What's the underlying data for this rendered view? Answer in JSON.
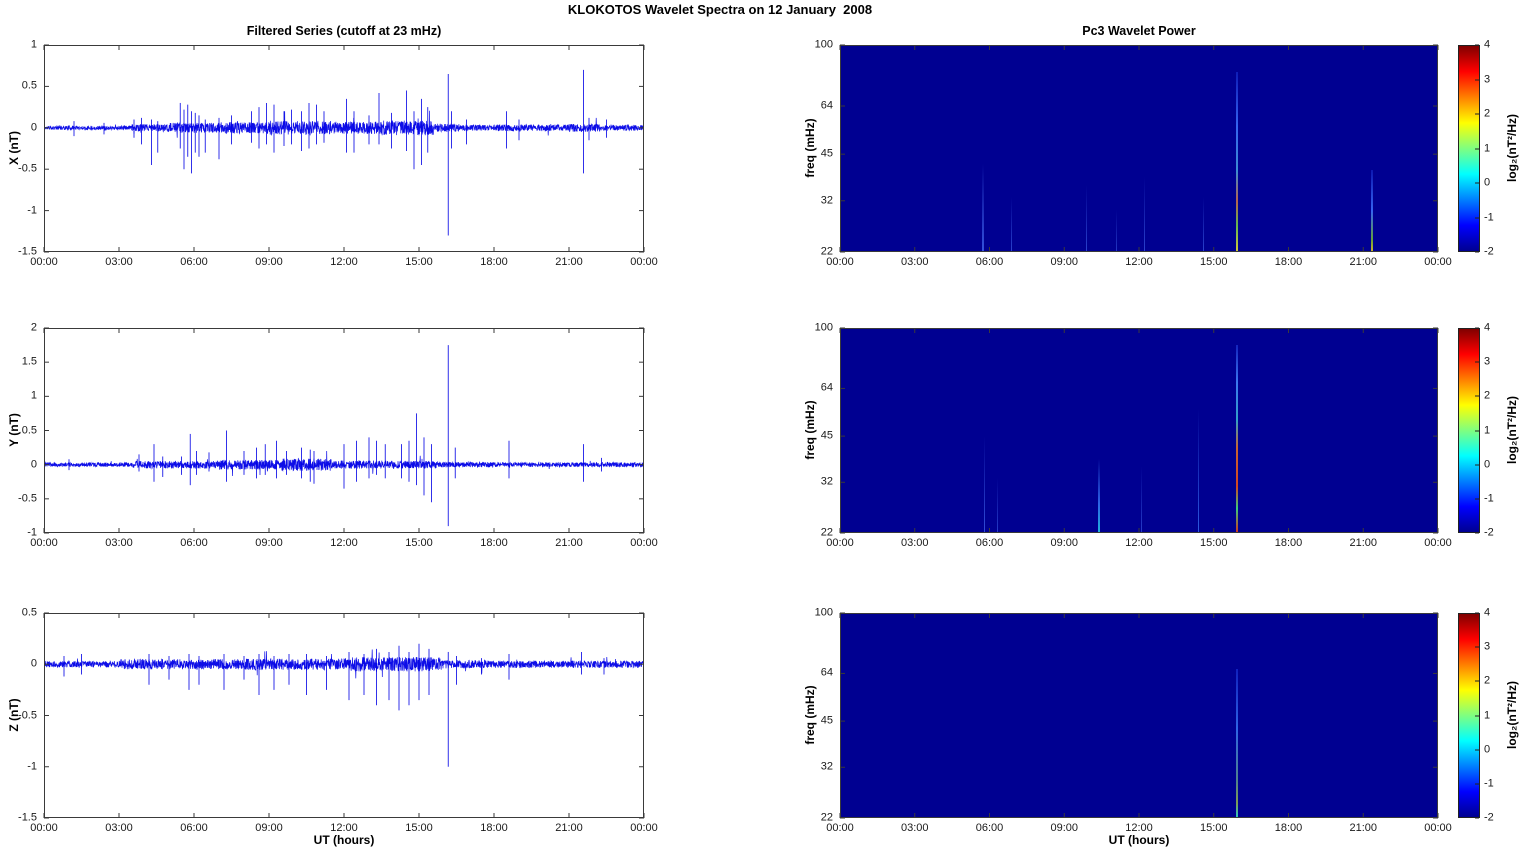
{
  "figure_title": "KLOKOTOS Wavelet Spectra on 12 January  2008",
  "xlabel": "UT (hours)",
  "x_tick_labels": [
    "00:00",
    "03:00",
    "06:00",
    "09:00",
    "12:00",
    "15:00",
    "18:00",
    "21:00",
    "00:00"
  ],
  "colors": {
    "series_line": "#0000E6",
    "spectrogram_background": "#000091",
    "axis": "#3a3a3a",
    "figure_background": "#ffffff"
  },
  "colorbar": {
    "label": "log₂(nT²/Hz)",
    "min": -2,
    "max": 4,
    "ticks": [
      "4",
      "3",
      "2",
      "1",
      "0",
      "-1",
      "-2"
    ],
    "gradient": [
      [
        "#000091",
        0
      ],
      [
        "#0000ff",
        12.5
      ],
      [
        "#00ffff",
        37.5
      ],
      [
        "#ffff00",
        62.5
      ],
      [
        "#ff0000",
        87.5
      ],
      [
        "#800000",
        100
      ]
    ]
  },
  "chart_data": [
    {
      "type": "line",
      "name": "X filtered series",
      "title": "Filtered Series (cutoff at 23 mHz)",
      "ylabel": "X (nT)",
      "ylim": [
        -1.5,
        1
      ],
      "yticks": [
        [
          1,
          "1"
        ],
        [
          0.5,
          "0.5"
        ],
        [
          0,
          "0"
        ],
        [
          -0.5,
          "-0.5"
        ],
        [
          -1,
          "-1"
        ],
        [
          -1.5,
          "-1.5"
        ]
      ],
      "xlim_hours": [
        0,
        24
      ],
      "seed": 11,
      "noise_envelope": [
        [
          0,
          3.5,
          0.025
        ],
        [
          3.5,
          5,
          0.045
        ],
        [
          5,
          7,
          0.06
        ],
        [
          7,
          9,
          0.07
        ],
        [
          9,
          11.5,
          0.085
        ],
        [
          11.5,
          13.5,
          0.075
        ],
        [
          13.5,
          15.6,
          0.09
        ],
        [
          15.6,
          16.6,
          0.05
        ],
        [
          16.6,
          18,
          0.035
        ],
        [
          18,
          21,
          0.04
        ],
        [
          21,
          22.3,
          0.05
        ],
        [
          22.3,
          24,
          0.035
        ]
      ],
      "spikes": [
        [
          1.2,
          0.08,
          -0.1
        ],
        [
          2.4,
          0.06,
          -0.08
        ],
        [
          3.6,
          0.1,
          -0.12
        ],
        [
          3.9,
          0.12,
          -0.2
        ],
        [
          4.3,
          0.1,
          -0.45
        ],
        [
          4.55,
          0.08,
          -0.3
        ],
        [
          5.45,
          0.3,
          -0.25
        ],
        [
          5.6,
          0.22,
          -0.5
        ],
        [
          5.75,
          0.28,
          -0.35
        ],
        [
          5.9,
          0.2,
          -0.55
        ],
        [
          6.05,
          0.18,
          -0.3
        ],
        [
          6.2,
          0.15,
          -0.35
        ],
        [
          6.45,
          0.1,
          -0.3
        ],
        [
          7.0,
          0.12,
          -0.38
        ],
        [
          7.5,
          0.15,
          -0.2
        ],
        [
          8.3,
          0.2,
          -0.18
        ],
        [
          8.6,
          0.25,
          -0.25
        ],
        [
          8.9,
          0.3,
          -0.2
        ],
        [
          9.2,
          0.28,
          -0.3
        ],
        [
          9.6,
          0.2,
          -0.22
        ],
        [
          9.9,
          0.22,
          -0.2
        ],
        [
          10.3,
          0.2,
          -0.28
        ],
        [
          10.6,
          0.3,
          -0.25
        ],
        [
          10.9,
          0.28,
          -0.2
        ],
        [
          11.2,
          0.2,
          -0.18
        ],
        [
          12.1,
          0.35,
          -0.3
        ],
        [
          12.4,
          0.2,
          -0.3
        ],
        [
          13.0,
          0.15,
          -0.2
        ],
        [
          13.4,
          0.42,
          -0.2
        ],
        [
          13.9,
          0.18,
          -0.25
        ],
        [
          14.5,
          0.45,
          -0.28
        ],
        [
          14.8,
          0.2,
          -0.5
        ],
        [
          15.1,
          0.35,
          -0.45
        ],
        [
          15.35,
          0.25,
          -0.3
        ],
        [
          16.17,
          0.65,
          -1.3
        ],
        [
          16.3,
          0.2,
          -0.25
        ],
        [
          16.9,
          0.1,
          -0.2
        ],
        [
          18.5,
          0.2,
          -0.25
        ],
        [
          19.0,
          0.1,
          -0.15
        ],
        [
          21.58,
          0.7,
          -0.55
        ],
        [
          21.8,
          0.12,
          -0.15
        ],
        [
          22.5,
          0.1,
          -0.12
        ]
      ]
    },
    {
      "type": "heatmap",
      "name": "X Pc3 wavelet power",
      "title": "Pc3 Wavelet Power",
      "ylabel": "freq (mHz)",
      "yscale": "log",
      "ylim": [
        22,
        100
      ],
      "yticks": [
        [
          100,
          "100"
        ],
        [
          64,
          "64"
        ],
        [
          45,
          "45"
        ],
        [
          32,
          "32"
        ],
        [
          22,
          "22"
        ]
      ],
      "xlim_hours": [
        0,
        24
      ],
      "background_value": -2,
      "events": [
        {
          "t": 5.75,
          "f_top": 42,
          "w": 2,
          "stops": [
            [
              0,
              "rgba(60,95,235,0)"
            ],
            [
              100,
              "rgba(70,110,245,0.75)"
            ]
          ]
        },
        {
          "t": 6.9,
          "f_top": 33,
          "w": 1,
          "stops": [
            [
              0,
              "rgba(60,95,235,0)"
            ],
            [
              100,
              "rgba(70,110,245,0.6)"
            ]
          ]
        },
        {
          "t": 9.9,
          "f_top": 36,
          "w": 1,
          "stops": [
            [
              0,
              "rgba(60,95,235,0)"
            ],
            [
              100,
              "rgba(70,110,245,0.6)"
            ]
          ]
        },
        {
          "t": 11.1,
          "f_top": 30,
          "w": 1,
          "stops": [
            [
              0,
              "rgba(60,95,235,0)"
            ],
            [
              100,
              "rgba(70,110,245,0.5)"
            ]
          ]
        },
        {
          "t": 12.2,
          "f_top": 38,
          "w": 1,
          "stops": [
            [
              0,
              "rgba(60,95,235,0)"
            ],
            [
              100,
              "rgba(70,110,245,0.6)"
            ]
          ]
        },
        {
          "t": 14.6,
          "f_top": 33,
          "w": 1,
          "stops": [
            [
              0,
              "rgba(60,95,235,0)"
            ],
            [
              100,
              "rgba(70,110,245,0.6)"
            ]
          ]
        },
        {
          "t": 15.93,
          "f_top": 82,
          "w": 2,
          "stops": [
            [
              0,
              "rgba(40,80,255,0.35)"
            ],
            [
              30,
              "#3564f0"
            ],
            [
              55,
              "#3c8cd2"
            ],
            [
              72,
              "#b46450"
            ],
            [
              85,
              "#64b450"
            ],
            [
              100,
              "#d2c83c"
            ]
          ]
        },
        {
          "t": 21.35,
          "f_top": 40,
          "w": 2,
          "stops": [
            [
              0,
              "rgba(40,80,255,0.3)"
            ],
            [
              50,
              "#3564f0"
            ],
            [
              85,
              "#64a03c"
            ],
            [
              100,
              "#d2b42a"
            ]
          ]
        }
      ]
    },
    {
      "type": "line",
      "name": "Y filtered series",
      "title": "",
      "ylabel": "Y (nT)",
      "ylim": [
        -1,
        2
      ],
      "yticks": [
        [
          2,
          "2"
        ],
        [
          1.5,
          "1.5"
        ],
        [
          1,
          "1"
        ],
        [
          0.5,
          "0.5"
        ],
        [
          0,
          "0"
        ],
        [
          -0.5,
          "-0.5"
        ],
        [
          -1,
          "-1"
        ]
      ],
      "xlim_hours": [
        0,
        24
      ],
      "seed": 23,
      "noise_envelope": [
        [
          0,
          3.5,
          0.03
        ],
        [
          3.5,
          7,
          0.055
        ],
        [
          7,
          9.5,
          0.07
        ],
        [
          9.5,
          11.5,
          0.09
        ],
        [
          11.5,
          14,
          0.06
        ],
        [
          14,
          15.8,
          0.055
        ],
        [
          15.8,
          18,
          0.04
        ],
        [
          18,
          24,
          0.035
        ]
      ],
      "spikes": [
        [
          1.0,
          0.08,
          -0.08
        ],
        [
          3.8,
          0.15,
          -0.1
        ],
        [
          4.4,
          0.3,
          -0.25
        ],
        [
          4.75,
          0.12,
          -0.18
        ],
        [
          5.5,
          0.12,
          -0.15
        ],
        [
          5.85,
          0.45,
          -0.3
        ],
        [
          6.1,
          0.2,
          -0.15
        ],
        [
          6.6,
          0.18,
          -0.1
        ],
        [
          7.3,
          0.5,
          -0.25
        ],
        [
          8.0,
          0.2,
          -0.15
        ],
        [
          8.5,
          0.25,
          -0.2
        ],
        [
          8.85,
          0.3,
          -0.15
        ],
        [
          9.3,
          0.35,
          -0.2
        ],
        [
          9.7,
          0.2,
          -0.15
        ],
        [
          10.3,
          0.25,
          -0.2
        ],
        [
          10.65,
          0.22,
          -0.25
        ],
        [
          10.8,
          0.2,
          -0.28
        ],
        [
          12.0,
          0.3,
          -0.35
        ],
        [
          12.5,
          0.35,
          -0.25
        ],
        [
          13.0,
          0.4,
          -0.2
        ],
        [
          13.3,
          0.35,
          -0.15
        ],
        [
          13.65,
          0.3,
          -0.2
        ],
        [
          14.3,
          0.3,
          -0.2
        ],
        [
          14.6,
          0.35,
          -0.25
        ],
        [
          14.9,
          0.75,
          -0.3
        ],
        [
          15.2,
          0.4,
          -0.45
        ],
        [
          15.5,
          0.3,
          -0.55
        ],
        [
          16.17,
          1.75,
          -0.9
        ],
        [
          16.45,
          0.25,
          -0.2
        ],
        [
          18.6,
          0.35,
          -0.2
        ],
        [
          21.58,
          0.3,
          -0.25
        ],
        [
          22.3,
          0.1,
          -0.1
        ]
      ]
    },
    {
      "type": "heatmap",
      "name": "Y Pc3 wavelet power",
      "title": "",
      "ylabel": "freq (mHz)",
      "yscale": "log",
      "ylim": [
        22,
        100
      ],
      "yticks": [
        [
          100,
          "100"
        ],
        [
          64,
          "64"
        ],
        [
          45,
          "45"
        ],
        [
          32,
          "32"
        ],
        [
          22,
          "22"
        ]
      ],
      "xlim_hours": [
        0,
        24
      ],
      "background_value": -2,
      "events": [
        {
          "t": 5.8,
          "f_top": 45,
          "w": 1,
          "stops": [
            [
              0,
              "rgba(60,95,235,0)"
            ],
            [
              100,
              "rgba(70,110,245,0.7)"
            ]
          ]
        },
        {
          "t": 6.3,
          "f_top": 33,
          "w": 1,
          "stops": [
            [
              0,
              "rgba(60,95,235,0)"
            ],
            [
              100,
              "rgba(70,110,245,0.55)"
            ]
          ]
        },
        {
          "t": 10.4,
          "f_top": 38,
          "w": 2,
          "stops": [
            [
              0,
              "rgba(60,95,235,0)"
            ],
            [
              60,
              "#2e64e6"
            ],
            [
              100,
              "#1eb4dc"
            ]
          ]
        },
        {
          "t": 12.1,
          "f_top": 36,
          "w": 1,
          "stops": [
            [
              0,
              "rgba(60,95,235,0)"
            ],
            [
              100,
              "rgba(70,110,245,0.55)"
            ]
          ]
        },
        {
          "t": 14.4,
          "f_top": 55,
          "w": 1,
          "stops": [
            [
              0,
              "rgba(60,95,235,0)"
            ],
            [
              100,
              "#2e5ae0"
            ]
          ]
        },
        {
          "t": 15.93,
          "f_top": 88,
          "w": 2.5,
          "stops": [
            [
              0,
              "rgba(50,90,255,0.4)"
            ],
            [
              20,
              "#3c78f0"
            ],
            [
              40,
              "#32a0c8"
            ],
            [
              55,
              "#c86432"
            ],
            [
              75,
              "#d24523"
            ],
            [
              87,
              "#3cc87d"
            ],
            [
              100,
              "#d2321e"
            ]
          ]
        }
      ]
    },
    {
      "type": "line",
      "name": "Z filtered series",
      "title": "",
      "ylabel": "Z (nT)",
      "ylim": [
        -1.5,
        0.5
      ],
      "yticks": [
        [
          0.5,
          "0.5"
        ],
        [
          0,
          "0"
        ],
        [
          -0.5,
          "-0.5"
        ],
        [
          -1,
          "-1"
        ],
        [
          -1.5,
          "-1.5"
        ]
      ],
      "xlim_hours": [
        0,
        24
      ],
      "seed": 37,
      "noise_envelope": [
        [
          0,
          3,
          0.03
        ],
        [
          3,
          8,
          0.05
        ],
        [
          8,
          12,
          0.055
        ],
        [
          12,
          16,
          0.07
        ],
        [
          16,
          18,
          0.04
        ],
        [
          18,
          24,
          0.035
        ]
      ],
      "spikes": [
        [
          0.8,
          0.08,
          -0.12
        ],
        [
          1.5,
          0.1,
          -0.1
        ],
        [
          4.2,
          0.1,
          -0.2
        ],
        [
          5.0,
          0.08,
          -0.15
        ],
        [
          5.8,
          0.1,
          -0.25
        ],
        [
          6.2,
          0.08,
          -0.2
        ],
        [
          7.2,
          0.1,
          -0.25
        ],
        [
          8.0,
          0.08,
          -0.15
        ],
        [
          8.6,
          0.1,
          -0.3
        ],
        [
          9.2,
          0.08,
          -0.25
        ],
        [
          9.8,
          0.1,
          -0.2
        ],
        [
          10.5,
          0.1,
          -0.3
        ],
        [
          11.3,
          0.08,
          -0.25
        ],
        [
          12.2,
          0.12,
          -0.35
        ],
        [
          12.8,
          0.1,
          -0.3
        ],
        [
          13.3,
          0.15,
          -0.4
        ],
        [
          13.8,
          0.12,
          -0.35
        ],
        [
          14.2,
          0.18,
          -0.45
        ],
        [
          14.6,
          0.12,
          -0.4
        ],
        [
          15.0,
          0.2,
          -0.35
        ],
        [
          15.4,
          0.15,
          -0.3
        ],
        [
          16.17,
          0.12,
          -1.0
        ],
        [
          16.5,
          0.08,
          -0.2
        ],
        [
          17.5,
          0.06,
          -0.1
        ],
        [
          18.6,
          0.1,
          -0.15
        ],
        [
          21.5,
          0.12,
          -0.1
        ],
        [
          22.4,
          0.06,
          -0.1
        ]
      ]
    },
    {
      "type": "heatmap",
      "name": "Z Pc3 wavelet power",
      "title": "",
      "ylabel": "freq (mHz)",
      "yscale": "log",
      "ylim": [
        22,
        100
      ],
      "yticks": [
        [
          100,
          "100"
        ],
        [
          64,
          "64"
        ],
        [
          45,
          "45"
        ],
        [
          32,
          "32"
        ],
        [
          22,
          "22"
        ]
      ],
      "xlim_hours": [
        0,
        24
      ],
      "background_value": -2,
      "events": [
        {
          "t": 15.93,
          "f_top": 66,
          "w": 2,
          "stops": [
            [
              0,
              "rgba(40,80,255,0.4)"
            ],
            [
              40,
              "#2e64e6"
            ],
            [
              75,
              "#50828c"
            ],
            [
              90,
              "#7d9b55"
            ],
            [
              100,
              "#28c8c8"
            ]
          ]
        }
      ]
    }
  ]
}
